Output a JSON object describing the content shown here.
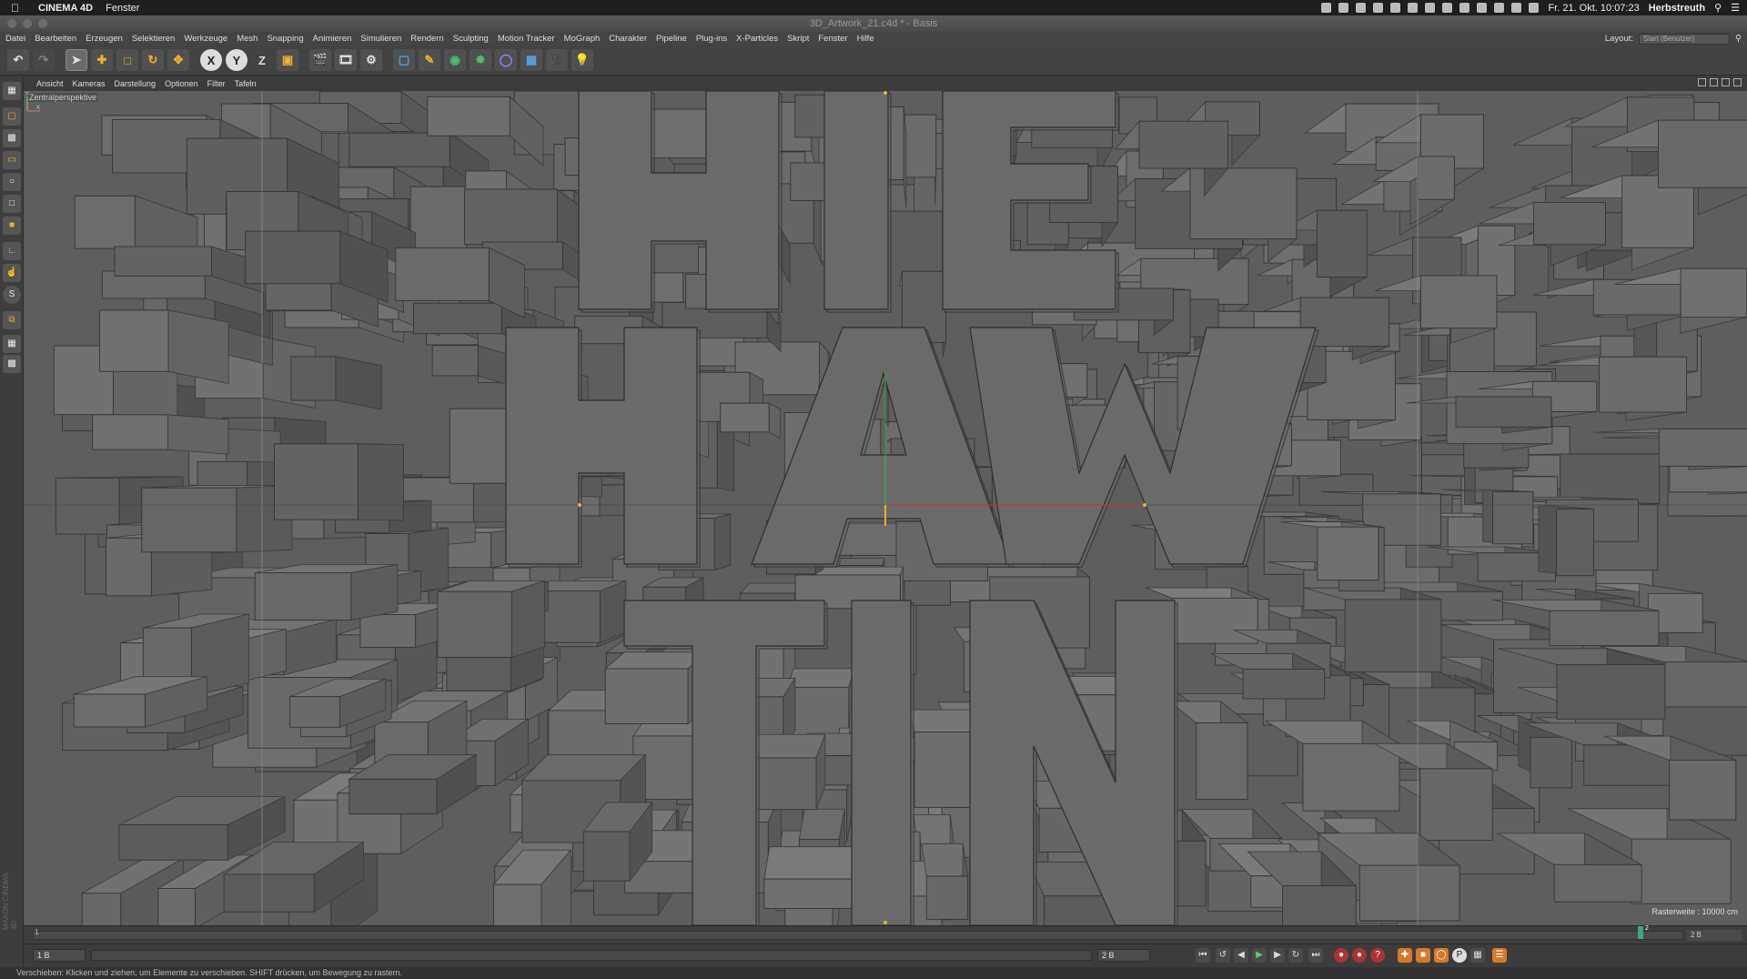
{
  "macos": {
    "app_name": "CINEMA 4D",
    "menu": [
      "Fenster"
    ],
    "clock": "Fr. 21. Okt.  10:07:23",
    "user": "Herbstreuth"
  },
  "window": {
    "title": "3D_Artwork_21.c4d * - Basis"
  },
  "app_menu": {
    "items": [
      "Datei",
      "Bearbeiten",
      "Erzeugen",
      "Selektieren",
      "Werkzeuge",
      "Mesh",
      "Snapping",
      "Animieren",
      "Simulieren",
      "Rendern",
      "Sculpting",
      "Motion Tracker",
      "MoGraph",
      "Charakter",
      "Pipeline",
      "Plug-ins",
      "X-Particles",
      "Skript",
      "Fenster",
      "Hilfe"
    ],
    "layout_label": "Layout:",
    "layout_value": "Start (Benutzer)"
  },
  "toolbar": {
    "axis_x": "X",
    "axis_y": "Y",
    "axis_z": "Z"
  },
  "view_menu": [
    "Ansicht",
    "Kameras",
    "Darstellung",
    "Optionen",
    "Filter",
    "Tafeln"
  ],
  "viewport": {
    "camera_label": "Zentralperspektive",
    "grid_info": "Rasterweite : 10000 cm",
    "axis_y": "Y",
    "axis_x": "X"
  },
  "timeline": {
    "ruler_start": "1",
    "playhead_label": "2",
    "end_frame": "2 B"
  },
  "transport": {
    "current_frame": "1 B",
    "end_frame": "2 B"
  },
  "branding": "MAXON CINEMA 4D",
  "status": "Verschieben: Klicken und ziehen, um Elemente zu verschieben. SHIFT drücken, um Bewegung zu rastern."
}
